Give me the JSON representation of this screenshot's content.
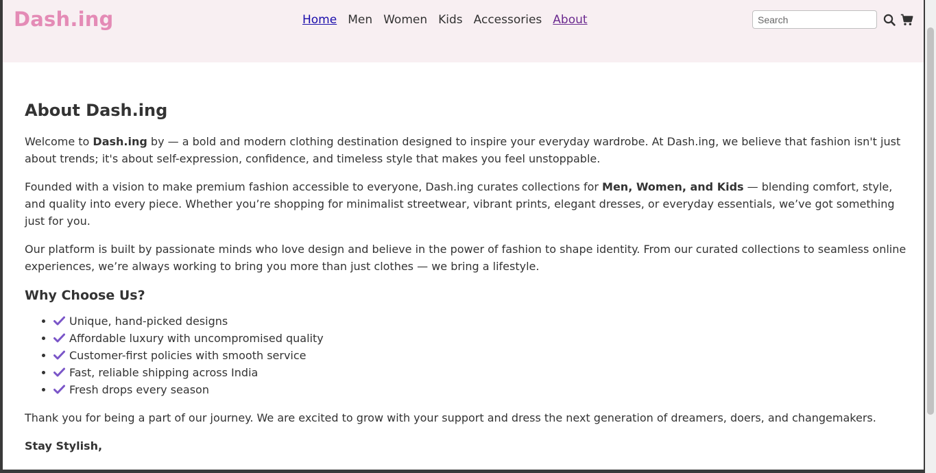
{
  "header": {
    "logo": "Dash.ing",
    "nav": [
      "Home",
      "Men",
      "Women",
      "Kids",
      "Accessories",
      "About"
    ],
    "search_placeholder": "Search",
    "search_icon": "search-icon",
    "cart_icon": "cart-icon",
    "accent_color": "#e48bb6",
    "background_color": "#f8eff2"
  },
  "about": {
    "title": "About Dash.ing",
    "p1": {
      "before": "Welcome to ",
      "bold": "Dash.ing",
      "after": " by — a bold and modern clothing destination designed to inspire your everyday wardrobe. At Dash.ing, we believe that fashion isn't just about trends; it's about self-expression, confidence, and timeless style that makes you feel unstoppable."
    },
    "p2": {
      "before": "Founded with a vision to make premium fashion accessible to everyone, Dash.ing curates collections for ",
      "bold": "Men, Women, and Kids",
      "after": " — blending comfort, style, and quality into every piece. Whether you’re shopping for minimalist streetwear, vibrant prints, elegant dresses, or everyday essentials, we’ve got something just for you."
    },
    "p3": "Our platform is built by passionate minds who love design and believe in the power of fashion to shape identity. From our curated collections to seamless online experiences, we’re always working to bring you more than just clothes — we bring a lifestyle.",
    "why_title": "Why Choose Us?",
    "why_items": [
      "Unique, hand-picked designs",
      "Affordable luxury with uncompromised quality",
      "Customer-first policies with smooth service",
      "Fast, reliable shipping across India",
      "Fresh drops every season"
    ],
    "check_icon": "check-icon",
    "check_color": "#7a55c8",
    "thanks": "Thank you for being a part of our journey. We are excited to grow with your support and dress the next generation of dreamers, doers, and changemakers.",
    "signoff": "Stay Stylish,"
  }
}
